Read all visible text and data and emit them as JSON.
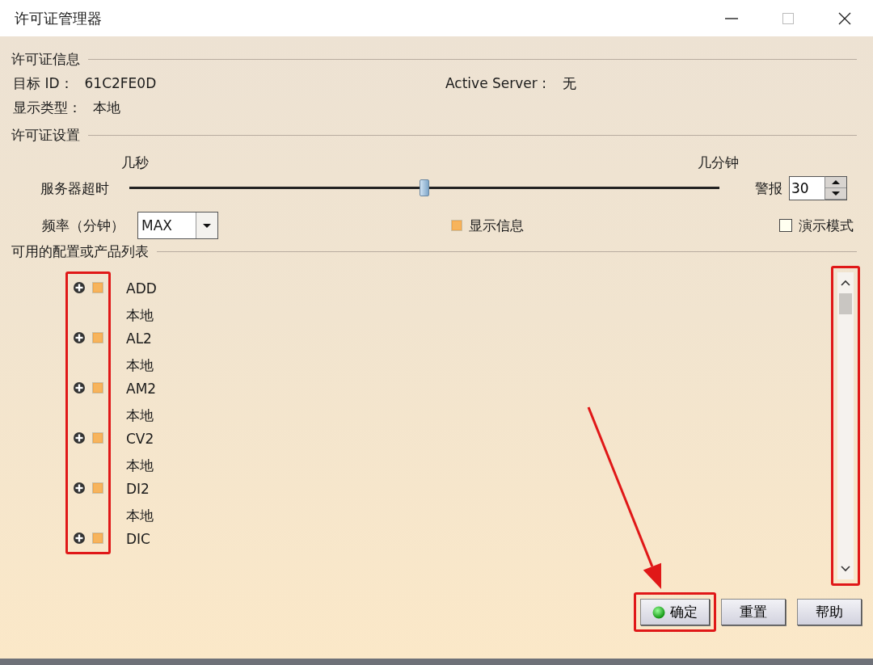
{
  "window": {
    "title": "许可证管理器"
  },
  "license_info": {
    "heading": "许可证信息",
    "target_id_label": "目标 ID：",
    "target_id": "61C2FE0D",
    "server_label": "Active Server :",
    "server": "无",
    "display_type_label": "显示类型：",
    "display_type": "本地"
  },
  "license_settings": {
    "heading": "许可证设置",
    "slider_min_label": "几秒",
    "slider_max_label": "几分钟",
    "timeout_label": "服务器超时",
    "timeout_slider": {
      "level": 0.5
    },
    "alarm_label": "警报",
    "alarm_value": "30",
    "frequency_label": "频率（分钟）",
    "frequency_value": "MAX",
    "show_info": {
      "label": "显示信息",
      "checked": true
    },
    "demo_mode": {
      "label": "演示模式",
      "checked": false
    }
  },
  "product_list": {
    "heading": "可用的配置或产品列表",
    "highlighted": true,
    "scrollbar_highlighted": true,
    "items": [
      {
        "name": "ADD",
        "location": "本地",
        "expanded": false,
        "checked": true
      },
      {
        "name": "AL2",
        "location": "本地",
        "expanded": false,
        "checked": true
      },
      {
        "name": "AM2",
        "location": "本地",
        "expanded": false,
        "checked": true
      },
      {
        "name": "CV2",
        "location": "本地",
        "expanded": false,
        "checked": true
      },
      {
        "name": "DI2",
        "location": "本地",
        "expanded": false,
        "checked": true
      },
      {
        "name": "DIC",
        "expanded": false,
        "checked": true
      }
    ]
  },
  "buttons": [
    {
      "label": "确定",
      "kind": "ok",
      "highlighted": true,
      "pointed": true
    },
    {
      "label": "重置",
      "kind": "plain",
      "highlighted": false,
      "pointed": false
    },
    {
      "label": "帮助",
      "kind": "plain",
      "highlighted": false,
      "pointed": false
    }
  ]
}
